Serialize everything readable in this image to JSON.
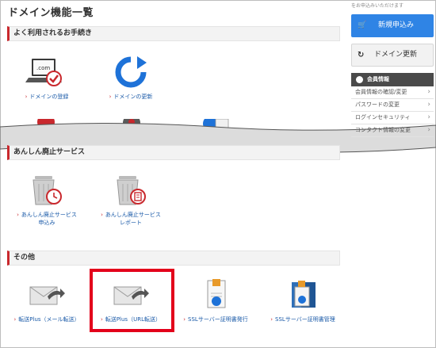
{
  "page_title": "ドメイン機能一覧",
  "sections": {
    "frequent": "よく利用されるお手続き",
    "anshin": "あんしん廃止サービス",
    "other": "その他"
  },
  "frequent_items": [
    {
      "label": "ドメインの登録",
      "icon": "domain-register-icon"
    },
    {
      "label": "ドメインの更新",
      "icon": "domain-renew-icon"
    }
  ],
  "anshin_items": [
    {
      "line1": "あんしん廃止サービス",
      "line2": "申込み",
      "icon": "trash-clock-icon"
    },
    {
      "line1": "あんしん廃止サービス",
      "line2": "レポート",
      "icon": "trash-report-icon"
    }
  ],
  "other_items": [
    {
      "label": "転送Plus（メール転送）",
      "icon": "mail-forward-icon"
    },
    {
      "label": "転送Plus（URL転送）",
      "icon": "url-forward-icon"
    },
    {
      "label": "SSLサーバー証明書発行",
      "icon": "ssl-certificate-icon"
    },
    {
      "label": "SSLサーバー証明書管理",
      "icon": "ssl-management-icon"
    }
  ],
  "sidebar": {
    "top_text": "をお申込みいただけます",
    "new_button": "新規申込み",
    "renew_button": "ドメイン更新",
    "account_header": "会員情報",
    "account_items": [
      "会員情報の確認/変更",
      "パスワードの変更",
      "ログインセキュリティ",
      "コンタクト情報の変更"
    ]
  },
  "colors": {
    "accent_red": "#c9282d",
    "link_blue": "#1a5aa8",
    "button_blue": "#2f84e5",
    "highlight": "#e3001b"
  }
}
